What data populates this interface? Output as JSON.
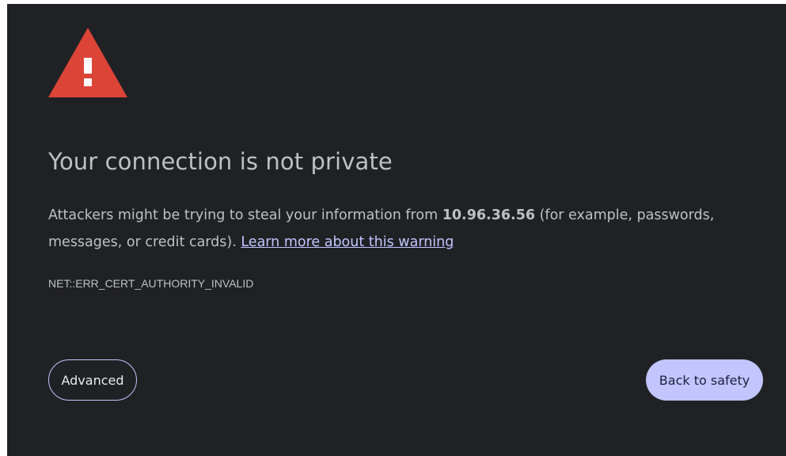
{
  "interstitial": {
    "icon": "warning-triangle-icon",
    "icon_color": "#db4437",
    "title": "Your connection is not private",
    "message_pre": "Attackers might be trying to steal your information from ",
    "host": "10.96.36.56",
    "message_post": " (for example, passwords, messages, or credit cards). ",
    "learn_more": "Learn more about this warning",
    "error_code": "NET::ERR_CERT_AUTHORITY_INVALID",
    "advanced_label": "Advanced",
    "back_label": "Back to safety"
  },
  "colors": {
    "background": "#202124",
    "text": "#bdc1c6",
    "accent": "#c2c5ff"
  }
}
